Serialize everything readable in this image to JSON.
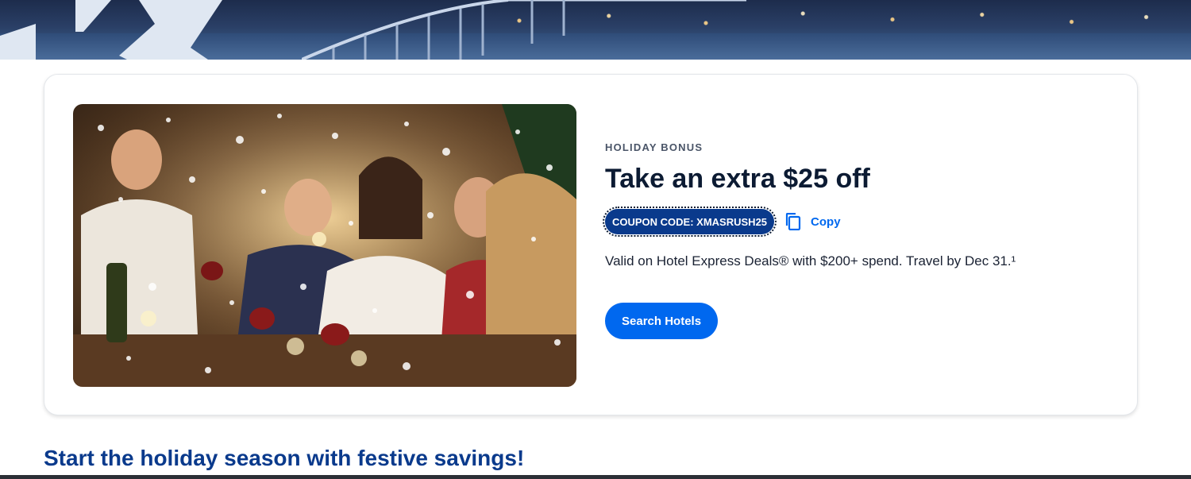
{
  "hero": {
    "image": "night-bridge-cityscape"
  },
  "promo": {
    "image": "friends-holiday-dinner-sparklers",
    "eyebrow": "HOLIDAY BONUS",
    "headline": "Take an extra $25 off",
    "coupon_label": "COUPON CODE: XMASRUSH25",
    "copy_icon": "copy-icon",
    "copy_label": "Copy",
    "terms": "Valid on Hotel Express Deals® with $200+ spend. Travel by Dec 31.¹",
    "cta_label": "Search Hotels"
  },
  "section": {
    "title": "Start the holiday season with festive savings!"
  },
  "colors": {
    "brand_blue": "#0068ef",
    "navy": "#0a3a8c",
    "headline": "#0c1b33"
  }
}
